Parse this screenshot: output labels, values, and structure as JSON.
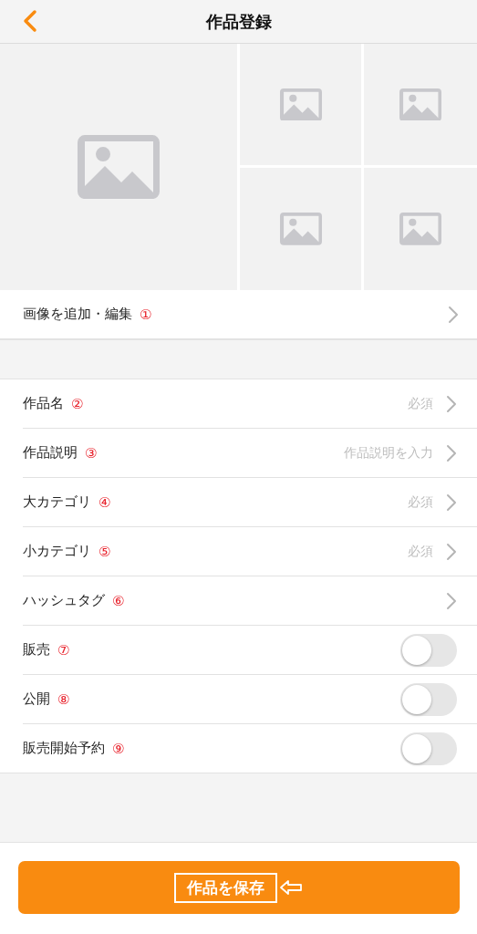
{
  "header": {
    "title": "作品登録"
  },
  "images": [
    {
      "kind": "placeholder"
    },
    {
      "kind": "placeholder"
    },
    {
      "kind": "placeholder"
    },
    {
      "kind": "placeholder"
    },
    {
      "kind": "placeholder"
    }
  ],
  "image_row": {
    "label": "画像を追加・編集",
    "marker": "①"
  },
  "rows": [
    {
      "kind": "link",
      "label": "作品名",
      "marker": "②",
      "hint": "必須"
    },
    {
      "kind": "link",
      "label": "作品説明",
      "marker": "③",
      "hint": "作品説明を入力"
    },
    {
      "kind": "link",
      "label": "大カテゴリ",
      "marker": "④",
      "hint": "必須"
    },
    {
      "kind": "link",
      "label": "小カテゴリ",
      "marker": "⑤",
      "hint": "必須"
    },
    {
      "kind": "link",
      "label": "ハッシュタグ",
      "marker": "⑥"
    },
    {
      "kind": "toggle",
      "label": "販売",
      "marker": "⑦",
      "on": false
    },
    {
      "kind": "toggle",
      "label": "公開",
      "marker": "⑧",
      "on": false
    },
    {
      "kind": "toggle",
      "label": "販売開始予約",
      "marker": "⑨",
      "on": false
    }
  ],
  "save_button": {
    "label": "作品を保存"
  }
}
